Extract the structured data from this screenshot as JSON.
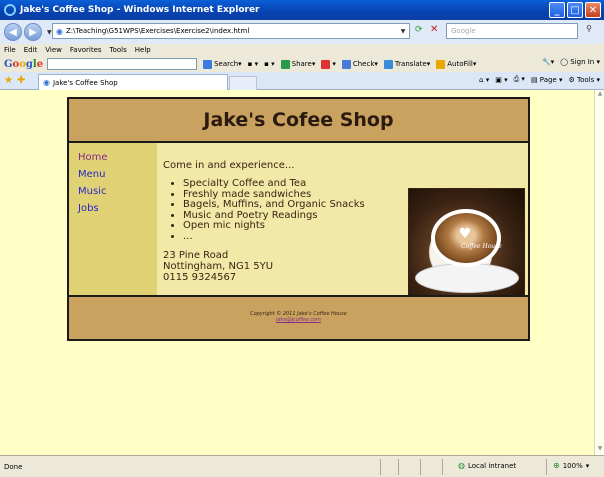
{
  "window": {
    "title": "Jake's Coffee Shop - Windows Internet Explorer"
  },
  "address_bar": {
    "url": "Z:\\Teaching\\G51WPS\\Exercises\\Exercise2\\index.html",
    "search_placeholder": "Google"
  },
  "menu": [
    "File",
    "Edit",
    "View",
    "Favorites",
    "Tools",
    "Help"
  ],
  "google_toolbar": {
    "logo_letters": [
      "G",
      "o",
      "o",
      "g",
      "l",
      "e"
    ],
    "search_label": "Search",
    "share_label": "Share",
    "check_label": "Check",
    "translate_label": "Translate",
    "autofill_label": "AutoFill",
    "signin_label": "Sign In"
  },
  "tab": {
    "title": "Jake's Coffee Shop"
  },
  "command_bar": {
    "page_label": "Page",
    "tools_label": "Tools"
  },
  "site": {
    "title": "Jake's Cofee Shop",
    "nav": [
      {
        "label": "Home",
        "visited": true
      },
      {
        "label": "Menu",
        "visited": false
      },
      {
        "label": "Music",
        "visited": false
      },
      {
        "label": "Jobs",
        "visited": false
      }
    ],
    "intro": "Come in and experience...",
    "features": [
      "Specialty Coffee and Tea",
      "Freshly made sandwiches",
      "Bagels, Muffins, and Organic Snacks",
      "Music and Poetry Readings",
      "Open mic nights",
      "..."
    ],
    "address": [
      "23 Pine Road",
      "Nottingham, NG1 5YU",
      "0115 9324567"
    ],
    "image_caption": "Coffee House",
    "footer_copyright": "Copyright © 2011 Jake's Coffee House",
    "footer_email": "jake@jcoffee.com"
  },
  "status": {
    "text": "Done",
    "zone": "Local intranet",
    "zoom": "100%"
  },
  "colors": {
    "page_background": "#ffffc6",
    "header_background": "#c9a25f",
    "nav_background": "#e0d274",
    "main_background": "#f2e8a8",
    "link": "#2727c9",
    "visited_link": "#8a2a8a"
  }
}
